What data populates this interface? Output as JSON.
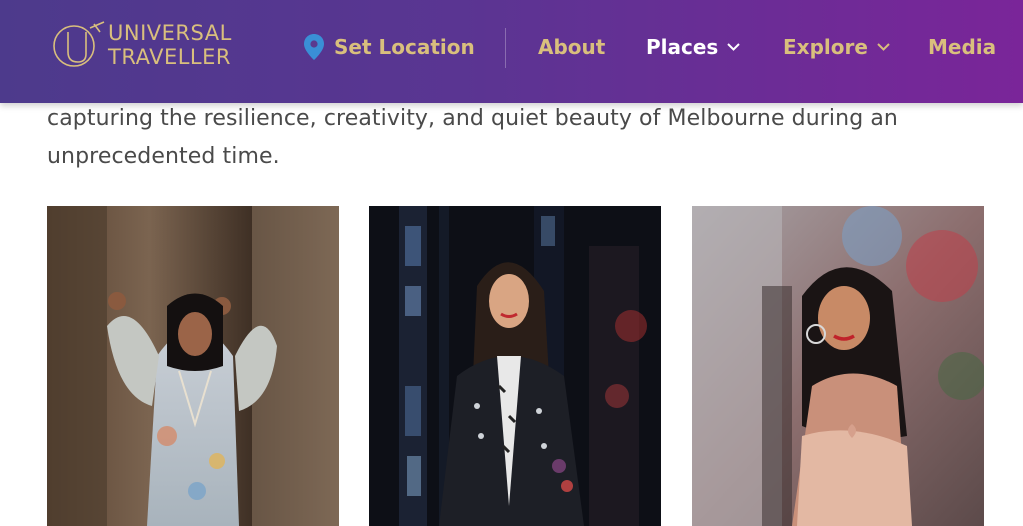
{
  "header": {
    "logo": {
      "line1": "UNIVERSAL",
      "line2": "TRAVELLER",
      "monogram": "UT"
    },
    "nav": {
      "set_location": "Set Location",
      "about": "About",
      "places": "Places",
      "explore": "Explore",
      "media": "Media"
    },
    "icons": {
      "location": "location-pin-icon",
      "dropdown": "chevron-down-icon"
    }
  },
  "intro_text": "capturing the resilience, creativity, and quiet beauty of Melbourne during an unprecedented time.",
  "gallery": [
    {
      "name": "photo-woman-floral-dress-tree"
    },
    {
      "name": "photo-woman-leather-jacket-night"
    },
    {
      "name": "photo-woman-pink-top-graffiti"
    }
  ],
  "colors": {
    "header_start": "#4d3a8c",
    "header_end": "#7a2599",
    "gold": "#d9bf7d",
    "pin_blue": "#3a8fd6",
    "body_text": "#4a4a4a"
  }
}
